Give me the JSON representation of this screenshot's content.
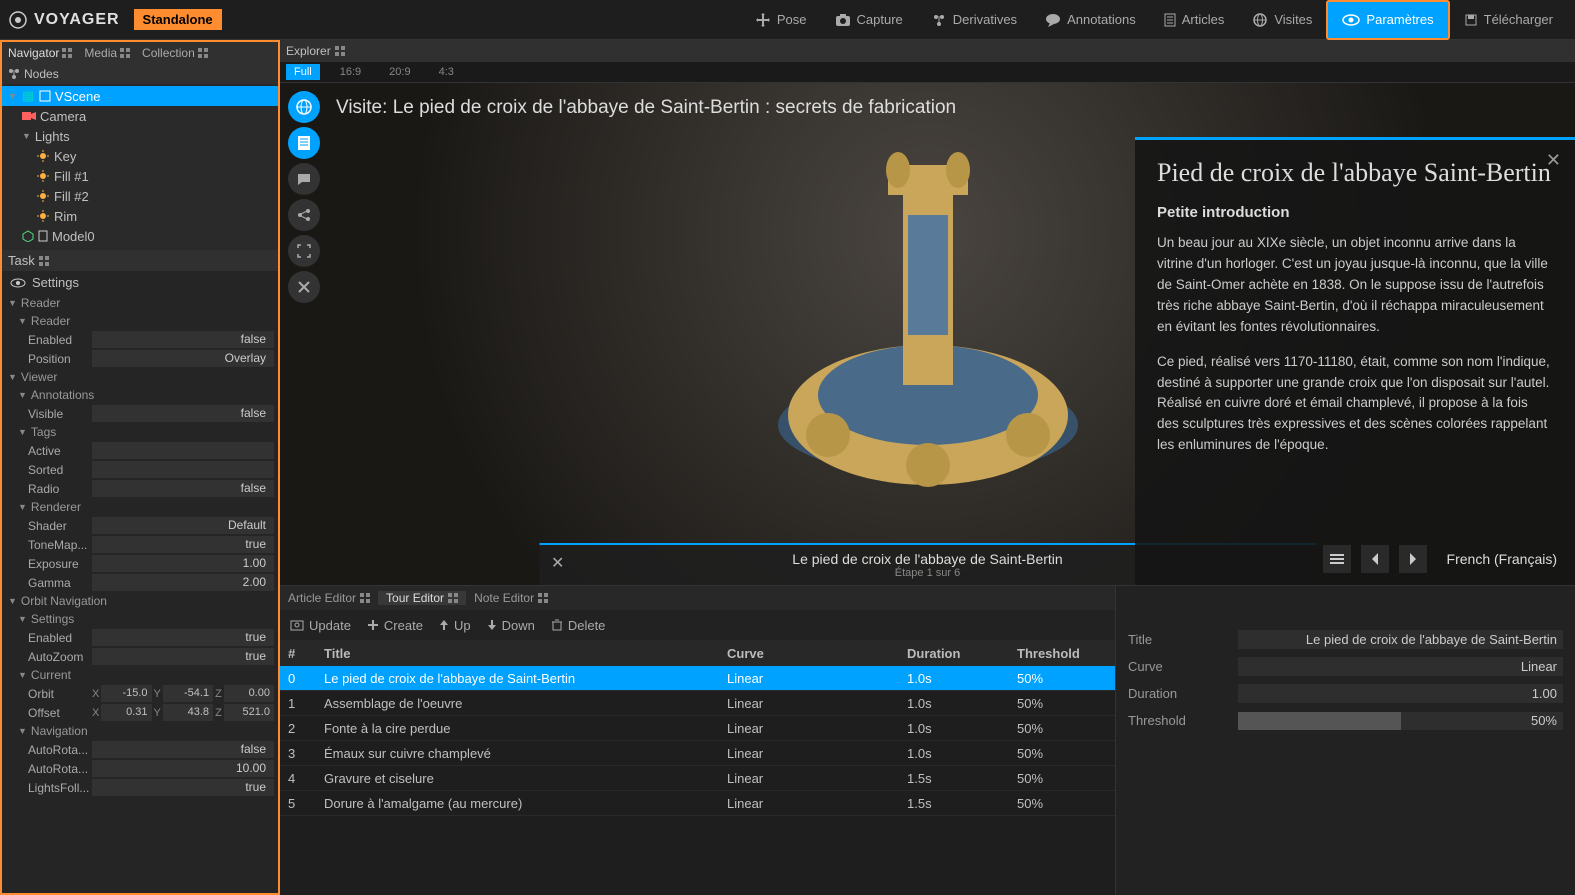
{
  "app": {
    "name": "VOYAGER",
    "mode": "Standalone"
  },
  "topnav": [
    {
      "label": "Pose",
      "icon": "move"
    },
    {
      "label": "Capture",
      "icon": "camera"
    },
    {
      "label": "Derivatives",
      "icon": "derivatives"
    },
    {
      "label": "Annotations",
      "icon": "chat"
    },
    {
      "label": "Articles",
      "icon": "doc"
    },
    {
      "label": "Visites",
      "icon": "globe"
    },
    {
      "label": "Paramètres",
      "icon": "eye",
      "active": true
    }
  ],
  "download": "Télécharger",
  "left_tabs": [
    "Navigator",
    "Media",
    "Collection"
  ],
  "nodes_label": "Nodes",
  "tree": {
    "scene": "VScene",
    "camera": "Camera",
    "lights": "Lights",
    "light_items": [
      "Key",
      "Fill #1",
      "Fill #2",
      "Rim"
    ],
    "model": "Model0"
  },
  "task_label": "Task",
  "settings_label": "Settings",
  "props": {
    "groups": [
      {
        "name": "Reader",
        "sub": [
          {
            "name": "Reader",
            "rows": [
              [
                "Enabled",
                "false"
              ],
              [
                "Position",
                "Overlay"
              ]
            ]
          }
        ]
      },
      {
        "name": "Viewer",
        "sub": [
          {
            "name": "Annotations",
            "rows": [
              [
                "Visible",
                "false"
              ]
            ]
          },
          {
            "name": "Tags",
            "rows": [
              [
                "Active",
                ""
              ],
              [
                "Sorted",
                ""
              ],
              [
                "Radio",
                "false"
              ]
            ]
          },
          {
            "name": "Renderer",
            "rows": [
              [
                "Shader",
                "Default"
              ],
              [
                "ToneMap...",
                "true"
              ],
              [
                "Exposure",
                "1.00"
              ],
              [
                "Gamma",
                "2.00"
              ]
            ]
          }
        ]
      },
      {
        "name": "Orbit Navigation",
        "sub": [
          {
            "name": "Settings",
            "rows": [
              [
                "Enabled",
                "true"
              ],
              [
                "AutoZoom",
                "true"
              ]
            ]
          },
          {
            "name": "Current",
            "xyz": [
              {
                "label": "Orbit",
                "x": "-15.0",
                "y": "-54.1",
                "z": "0.00"
              },
              {
                "label": "Offset",
                "x": "0.31",
                "y": "43.8",
                "z": "521.0"
              }
            ]
          },
          {
            "name": "Navigation",
            "rows": [
              [
                "AutoRota...",
                "false"
              ],
              [
                "AutoRota...",
                "10.00"
              ],
              [
                "LightsFoll...",
                "true"
              ]
            ]
          }
        ]
      }
    ]
  },
  "explorer_label": "Explorer",
  "aspects": [
    "Full",
    "16:9",
    "20:9",
    "4:3"
  ],
  "visite": {
    "prefix": "Visite: ",
    "title": "Le pied de croix de l'abbaye de Saint-Bertin : secrets de fabrication"
  },
  "step": {
    "title": "Le pied de croix de l'abbaye de Saint-Bertin",
    "sub": "Étape 1 sur 6"
  },
  "article": {
    "title": "Pied de croix de l'abbaye Saint-Bertin",
    "subtitle": "Petite introduction",
    "p1": "Un beau jour au XIXe siècle, un objet inconnu arrive dans la vitrine d'un horloger. C'est un joyau jusque-là inconnu, que la ville de Saint-Omer achète en 1838. On le suppose issu de l'autrefois très riche abbaye Saint-Bertin, d'où il réchappa miraculeusement en évitant les fontes révolutionnaires.",
    "p2": "Ce pied, réalisé vers 1170-11180, était, comme son nom l'indique, destiné à supporter une grande croix que l'on disposait sur l'autel. Réalisé en cuivre doré et émail champlevé, il propose à la fois des sculptures très expressives et des scènes colorées rappelant les enluminures de l'époque.",
    "lang": "French (Français)"
  },
  "editor_tabs": [
    "Article Editor",
    "Tour Editor",
    "Note Editor"
  ],
  "toolbar": [
    "Update",
    "Create",
    "Up",
    "Down",
    "Delete"
  ],
  "table": {
    "headers": {
      "idx": "#",
      "title": "Title",
      "curve": "Curve",
      "dur": "Duration",
      "thr": "Threshold"
    },
    "rows": [
      {
        "idx": "0",
        "title": "Le pied de croix de l'abbaye de Saint-Bertin",
        "curve": "Linear",
        "dur": "1.0s",
        "thr": "50%",
        "sel": true
      },
      {
        "idx": "1",
        "title": "Assemblage de l'oeuvre",
        "curve": "Linear",
        "dur": "1.0s",
        "thr": "50%"
      },
      {
        "idx": "2",
        "title": "Fonte à la cire perdue",
        "curve": "Linear",
        "dur": "1.0s",
        "thr": "50%"
      },
      {
        "idx": "3",
        "title": "Émaux sur cuivre champlevé",
        "curve": "Linear",
        "dur": "1.0s",
        "thr": "50%"
      },
      {
        "idx": "4",
        "title": "Gravure et ciselure",
        "curve": "Linear",
        "dur": "1.5s",
        "thr": "50%"
      },
      {
        "idx": "5",
        "title": "Dorure à l'amalgame (au mercure)",
        "curve": "Linear",
        "dur": "1.5s",
        "thr": "50%"
      }
    ]
  },
  "detail": {
    "title_lbl": "Title",
    "title_val": "Le pied de croix de l'abbaye de Saint-Bertin",
    "curve_lbl": "Curve",
    "curve_val": "Linear",
    "dur_lbl": "Duration",
    "dur_val": "1.00",
    "thr_lbl": "Threshold",
    "thr_val": "50%",
    "thr_pct": 50
  }
}
